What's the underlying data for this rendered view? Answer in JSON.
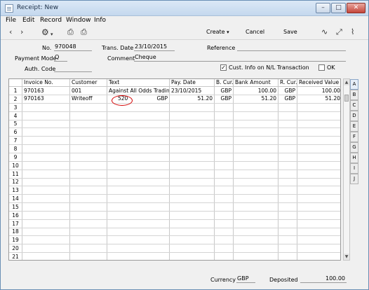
{
  "window": {
    "title": "Receipt: New"
  },
  "menu": [
    "File",
    "Edit",
    "Record",
    "Window",
    "Info"
  ],
  "toolbar": {
    "create": "Create",
    "cancel": "Cancel",
    "save": "Save"
  },
  "header": {
    "no_label": "No.",
    "no_value": "970048",
    "trans_date_label": "Trans. Date",
    "trans_date_value": "23/10/2015",
    "reference_label": "Reference",
    "reference_value": "",
    "payment_mode_label": "Payment Mode",
    "payment_mode_value": "Q",
    "comment_label": "Comment",
    "comment_value": "Cheque",
    "auth_code_label": "Auth. Code",
    "auth_code_value": "",
    "cust_info_label": "Cust. Info on N/L Transaction",
    "cust_info_checked": true,
    "ok_label": "OK",
    "ok_checked": false
  },
  "grid": {
    "columns": [
      "",
      "Invoice No.",
      "Customer",
      "Text",
      "",
      "Pay. Date",
      "B. Cur.",
      "Bank Amount",
      "R. Cur.",
      "Received Value"
    ],
    "rows": [
      [
        "1",
        "970163",
        "001",
        "Against All Odds Trading",
        "",
        "23/10/2015",
        "GBP",
        "100.00",
        "GBP",
        "100.00"
      ],
      [
        "2",
        "970163",
        "Writeoff",
        "520",
        "GBP",
        "",
        "GBP",
        "51.20",
        "GBP",
        "51.20"
      ]
    ],
    "row_numbers": [
      "1",
      "2",
      "3",
      "4",
      "5",
      "6",
      "7",
      "8",
      "9",
      "10",
      "11",
      "12",
      "13",
      "14",
      "15",
      "16",
      "17",
      "18",
      "19",
      "20",
      "21"
    ]
  },
  "cells_row2_extra": {
    "amount": "51.20"
  },
  "tabs": [
    "A",
    "B",
    "C",
    "D",
    "E",
    "F",
    "G",
    "H",
    "I",
    "J"
  ],
  "footer": {
    "currency_label": "Currency",
    "currency_value": "GBP",
    "deposited_label": "Deposited",
    "deposited_value": "100.00"
  },
  "colors": {
    "highlight_circle": "#d40000",
    "title_bar": "#c4d8ee"
  }
}
